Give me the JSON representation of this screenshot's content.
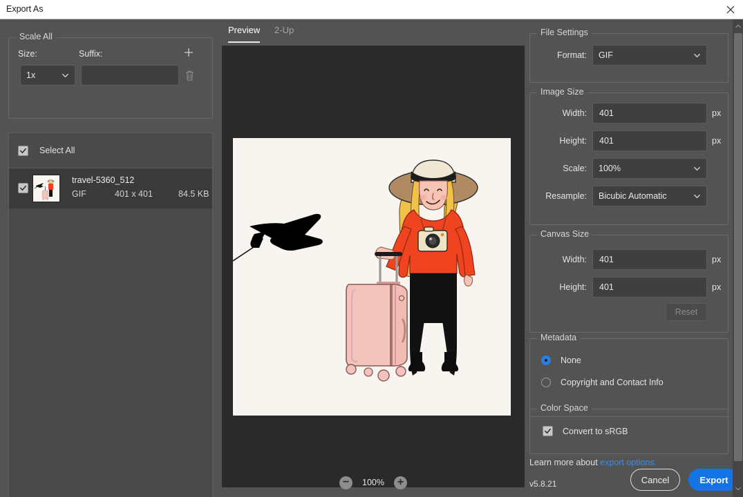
{
  "window": {
    "title": "Export As",
    "close_icon": "close-icon"
  },
  "scale_all": {
    "legend": "Scale All",
    "size_label": "Size:",
    "suffix_label": "Suffix:",
    "size_value": "1x",
    "suffix_value": "",
    "suffix_placeholder": "",
    "add_icon": "plus-icon",
    "delete_icon": "trash-icon"
  },
  "file_list": {
    "select_all_label": "Select All",
    "select_all_checked": true,
    "items": [
      {
        "name": "travel-5360_512",
        "format": "GIF",
        "dimensions": "401 x 401",
        "size": "84.5 KB",
        "checked": true,
        "selected": true
      }
    ]
  },
  "preview": {
    "tabs": [
      {
        "label": "Preview",
        "active": true
      },
      {
        "label": "2-Up",
        "active": false
      }
    ],
    "zoom_level": "100%",
    "zoom_out_icon": "minus-circle-icon",
    "zoom_in_icon": "plus-circle-icon",
    "artwork": {
      "description": "Illustration of a blonde woman in a sun hat and red sweater with a camera, standing beside a pink rolling suitcase, with a black airplane silhouette flying at upper left",
      "background_color": "#f8f5f1",
      "sweater_color": "#f03c1e",
      "suitcase_color": "#f2c3bd",
      "hair_color": "#f2c14a",
      "hat_color": "#b08a63",
      "skin_color": "#f6c3b4",
      "pants_color": "#111111"
    }
  },
  "file_settings": {
    "legend": "File Settings",
    "format_label": "Format:",
    "format_value": "GIF"
  },
  "image_size": {
    "legend": "Image Size",
    "width_label": "Width:",
    "width_value": "401",
    "width_unit": "px",
    "height_label": "Height:",
    "height_value": "401",
    "height_unit": "px",
    "scale_label": "Scale:",
    "scale_value": "100%",
    "resample_label": "Resample:",
    "resample_value": "Bicubic Automatic"
  },
  "canvas_size": {
    "legend": "Canvas Size",
    "width_label": "Width:",
    "width_value": "401",
    "width_unit": "px",
    "height_label": "Height:",
    "height_value": "401",
    "height_unit": "px",
    "reset_label": "Reset"
  },
  "metadata": {
    "legend": "Metadata",
    "options": [
      {
        "label": "None",
        "selected": true
      },
      {
        "label": "Copyright and Contact Info",
        "selected": false
      }
    ]
  },
  "color_space": {
    "legend": "Color Space",
    "convert_label": "Convert to sRGB",
    "convert_checked": true
  },
  "footer": {
    "learn_prefix": "Learn more about ",
    "learn_link": "export options.",
    "version": "v5.8.21",
    "cancel_label": "Cancel",
    "export_label": "Export"
  },
  "colors": {
    "accent": "#1473e6",
    "link": "#3a8ee0",
    "panel_bg": "#535353",
    "preview_bg": "#2a2a2a",
    "field_bg": "#3f3f3f"
  }
}
